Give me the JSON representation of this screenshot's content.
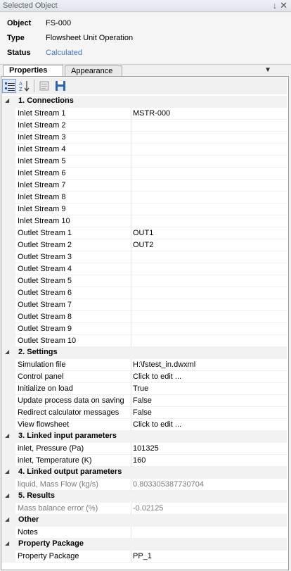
{
  "window": {
    "title": "Selected Object",
    "pin_glyph": "↓",
    "close_glyph": "✕"
  },
  "info": {
    "object_label": "Object",
    "object_value": "FS-000",
    "type_label": "Type",
    "type_value": "Flowsheet Unit Operation",
    "status_label": "Status",
    "status_value": "Calculated"
  },
  "tabs": {
    "properties": "Properties",
    "appearance": "Appearance",
    "menu_glyph": "▼"
  },
  "grid": {
    "rows": [
      {
        "kind": "cat",
        "title": "1. Connections"
      },
      {
        "kind": "prop",
        "name": "Inlet Stream 1",
        "value": "MSTR-000"
      },
      {
        "kind": "prop",
        "name": "Inlet Stream 2",
        "value": ""
      },
      {
        "kind": "prop",
        "name": "Inlet Stream 3",
        "value": ""
      },
      {
        "kind": "prop",
        "name": "Inlet Stream 4",
        "value": ""
      },
      {
        "kind": "prop",
        "name": "Inlet Stream 5",
        "value": ""
      },
      {
        "kind": "prop",
        "name": "Inlet Stream 6",
        "value": ""
      },
      {
        "kind": "prop",
        "name": "Inlet Stream 7",
        "value": ""
      },
      {
        "kind": "prop",
        "name": "Inlet Stream 8",
        "value": ""
      },
      {
        "kind": "prop",
        "name": "Inlet Stream 9",
        "value": ""
      },
      {
        "kind": "prop",
        "name": "Inlet Stream 10",
        "value": ""
      },
      {
        "kind": "prop",
        "name": "Outlet Stream 1",
        "value": "OUT1"
      },
      {
        "kind": "prop",
        "name": "Outlet Stream 2",
        "value": "OUT2"
      },
      {
        "kind": "prop",
        "name": "Outlet Stream 3",
        "value": ""
      },
      {
        "kind": "prop",
        "name": "Outlet Stream 4",
        "value": ""
      },
      {
        "kind": "prop",
        "name": "Outlet Stream 5",
        "value": ""
      },
      {
        "kind": "prop",
        "name": "Outlet Stream 6",
        "value": ""
      },
      {
        "kind": "prop",
        "name": "Outlet Stream 7",
        "value": ""
      },
      {
        "kind": "prop",
        "name": "Outlet Stream 8",
        "value": ""
      },
      {
        "kind": "prop",
        "name": "Outlet Stream 9",
        "value": ""
      },
      {
        "kind": "prop",
        "name": "Outlet Stream 10",
        "value": ""
      },
      {
        "kind": "cat",
        "title": "2. Settings"
      },
      {
        "kind": "prop",
        "name": "Simulation file",
        "value": "H:\\fstest_in.dwxml"
      },
      {
        "kind": "prop",
        "name": "Control panel",
        "value": "Click to edit ..."
      },
      {
        "kind": "prop",
        "name": "Initialize on load",
        "value": "True"
      },
      {
        "kind": "prop",
        "name": "Update process data on saving",
        "value": "False"
      },
      {
        "kind": "prop",
        "name": "Redirect calculator messages",
        "value": "False"
      },
      {
        "kind": "prop",
        "name": "View flowsheet",
        "value": "Click to edit ..."
      },
      {
        "kind": "cat",
        "title": "3. Linked input parameters"
      },
      {
        "kind": "prop",
        "name": "inlet, Pressure (Pa)",
        "value": "101325"
      },
      {
        "kind": "prop",
        "name": "inlet, Temperature (K)",
        "value": "160"
      },
      {
        "kind": "cat",
        "title": "4. Linked output parameters"
      },
      {
        "kind": "prop",
        "name": "liquid, Mass Flow (kg/s)",
        "value": "0.803305387730704",
        "readonly": true
      },
      {
        "kind": "cat",
        "title": "5. Results"
      },
      {
        "kind": "prop",
        "name": "Mass balance error (%)",
        "value": "-0.02125",
        "readonly": true
      },
      {
        "kind": "cat",
        "title": "Other"
      },
      {
        "kind": "prop",
        "name": "Notes",
        "value": ""
      },
      {
        "kind": "cat",
        "title": "Property Package"
      },
      {
        "kind": "prop",
        "name": "Property Package",
        "value": "PP_1"
      }
    ]
  }
}
